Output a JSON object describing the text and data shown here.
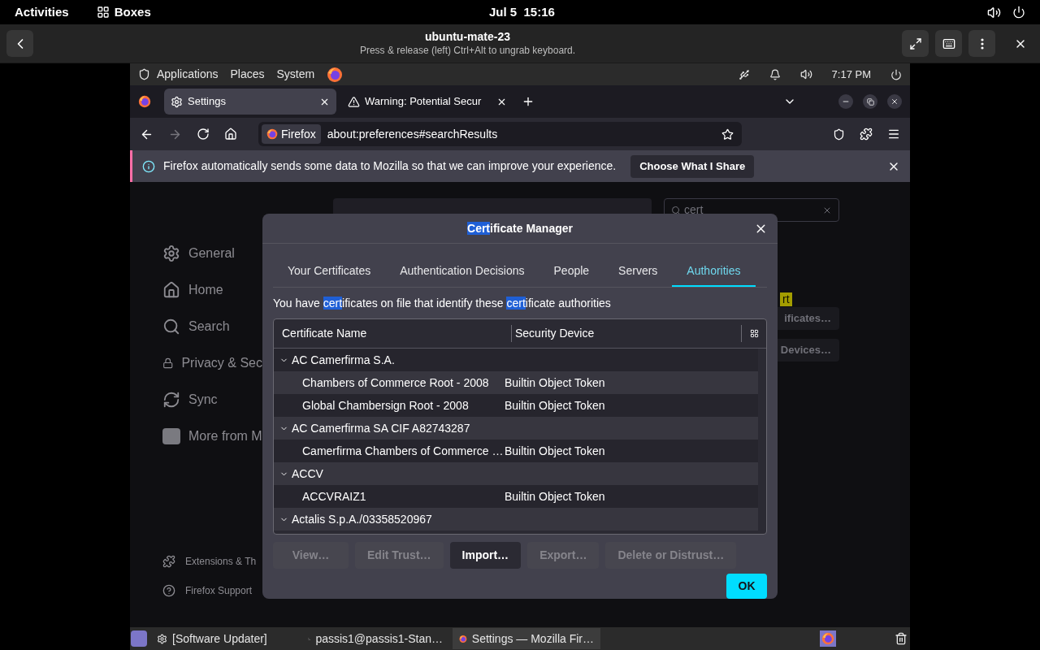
{
  "top_bar": {
    "activities": "Activities",
    "app": "Boxes",
    "clock": "Jul 5  15:16"
  },
  "boxes_header": {
    "title": "ubuntu-mate-23",
    "subtitle": "Press & release (left) Ctrl+Alt to ungrab keyboard."
  },
  "mate_panel": {
    "menus": [
      "Applications",
      "Places",
      "System"
    ],
    "clock": "7:17 PM"
  },
  "browser": {
    "tabs": [
      {
        "label": "Settings",
        "selected": true,
        "kind": "settings"
      },
      {
        "label": "Warning: Potential Secur",
        "selected": false,
        "kind": "warning"
      }
    ],
    "url_badge": "Firefox",
    "url": "about:preferences#searchResults",
    "notification": {
      "text": "Firefox automatically sends some data to Mozilla so that we can improve your experience.",
      "button": "Choose What I Share"
    }
  },
  "settings_page": {
    "sidebar": [
      {
        "label": "General",
        "kind": "gear"
      },
      {
        "label": "Home",
        "kind": "home"
      },
      {
        "label": "Search",
        "kind": "search"
      },
      {
        "label": "Privacy & Sec",
        "kind": "lock"
      },
      {
        "label": "Sync",
        "kind": "sync"
      },
      {
        "label": "More from M",
        "kind": "mozilla"
      }
    ],
    "footer": [
      {
        "label": "Extensions & Th",
        "kind": "puzzle"
      },
      {
        "label": "Firefox Support",
        "kind": "help"
      }
    ],
    "search": {
      "value": "cert"
    },
    "highlight": "rt",
    "buttons": [
      "ificates…",
      "Devices…"
    ]
  },
  "dialog": {
    "title": [
      {
        "text": "Cert",
        "highlighted": true
      },
      {
        "text": "ificate Manager",
        "highlighted": false
      }
    ],
    "tabs": [
      {
        "label": "Your Certificates",
        "selected": false
      },
      {
        "label": "Authentication Decisions",
        "selected": false
      },
      {
        "label": "People",
        "selected": false
      },
      {
        "label": "Servers",
        "selected": false
      },
      {
        "label": "Authorities",
        "selected": true
      }
    ],
    "description": [
      {
        "text": "You have ",
        "highlighted": false
      },
      {
        "text": "cert",
        "highlighted": true
      },
      {
        "text": "ificates on file that identify these ",
        "highlighted": false
      },
      {
        "text": "cert",
        "highlighted": true
      },
      {
        "text": "ificate authorities",
        "highlighted": false
      }
    ],
    "columns": [
      "Certificate Name",
      "Security Device"
    ],
    "groups": [
      {
        "name": "AC Camerfirma S.A.",
        "expanded": true,
        "children": [
          {
            "name": "Chambers of Commerce Root - 2008",
            "device": "Builtin Object Token"
          },
          {
            "name": "Global Chambersign Root - 2008",
            "device": "Builtin Object Token"
          }
        ]
      },
      {
        "name": "AC Camerfirma SA CIF A82743287",
        "expanded": true,
        "children": [
          {
            "name": "Camerfirma Chambers of Commerce …",
            "device": "Builtin Object Token"
          }
        ]
      },
      {
        "name": "ACCV",
        "expanded": true,
        "children": [
          {
            "name": "ACCVRAIZ1",
            "device": "Builtin Object Token"
          }
        ]
      },
      {
        "name": "Actalis S.p.A./03358520967",
        "expanded": true
      }
    ],
    "buttons": [
      {
        "label": "View…",
        "disabled": true
      },
      {
        "label": "Edit Trust…",
        "disabled": true
      },
      {
        "label": "Import…",
        "disabled": false
      },
      {
        "label": "Export…",
        "disabled": true
      },
      {
        "label": "Delete or Distrust…",
        "disabled": true
      }
    ],
    "ok": "OK"
  },
  "taskbar": {
    "items": [
      {
        "label": "[Software Updater]",
        "selected": false,
        "kind": "updater"
      },
      {
        "label": "passis1@passis1-Stan…",
        "selected": false,
        "kind": "terminal"
      },
      {
        "label": "Settings — Mozilla Fir…",
        "selected": true,
        "kind": "firefox"
      }
    ]
  }
}
